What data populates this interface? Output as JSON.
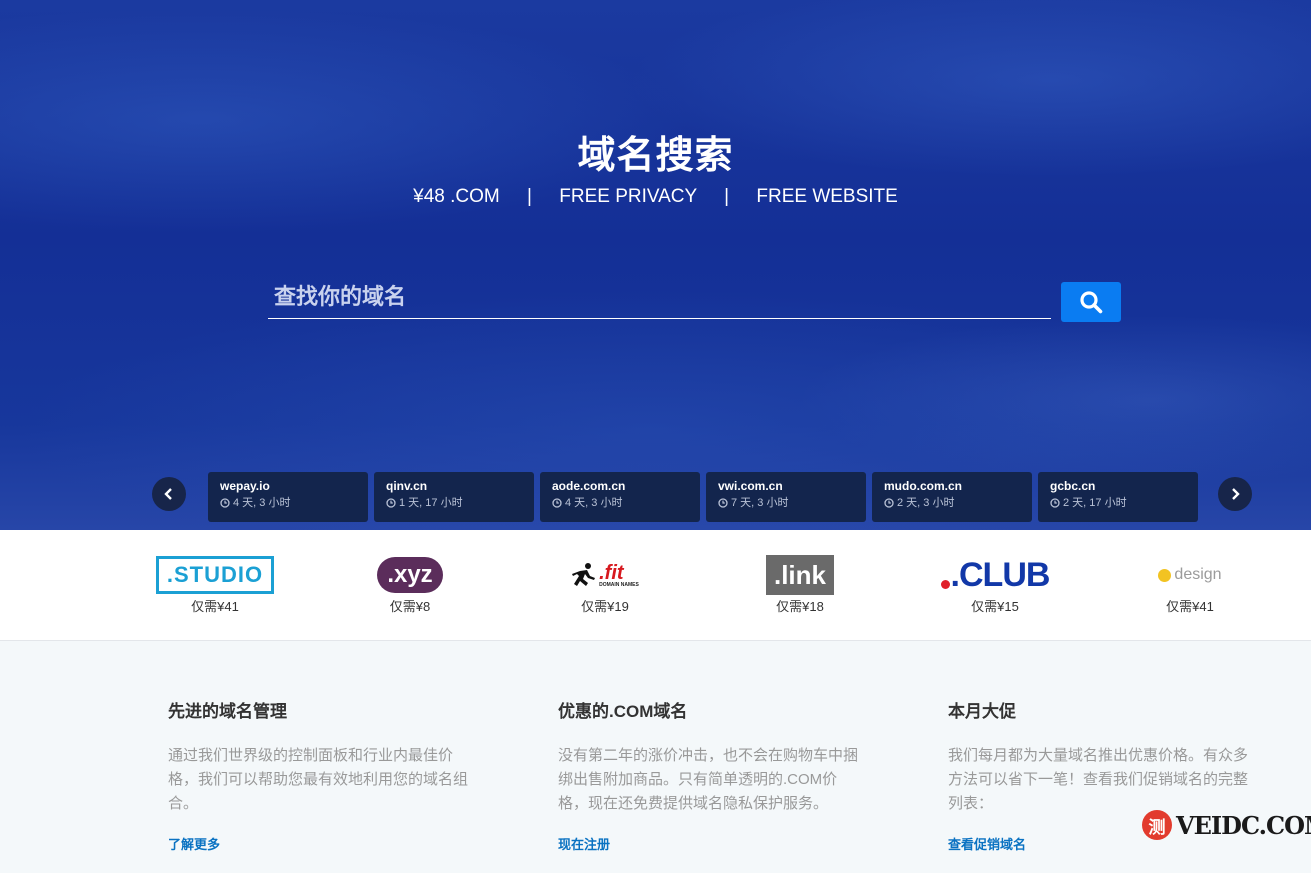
{
  "hero": {
    "title": "域名搜索",
    "tagline_1": "¥48 .COM",
    "tagline_sep": "|",
    "tagline_2": "FREE PRIVACY",
    "tagline_3": "FREE WEBSITE",
    "search_placeholder": "查找你的域名",
    "search_value": ""
  },
  "ticker": [
    {
      "domain": "wepay.io",
      "time": "4 天, 3 小时"
    },
    {
      "domain": "qinv.cn",
      "time": "1 天, 17 小时"
    },
    {
      "domain": "aode.com.cn",
      "time": "4 天, 3 小时"
    },
    {
      "domain": "vwi.com.cn",
      "time": "7 天, 3 小时"
    },
    {
      "domain": "mudo.com.cn",
      "time": "2 天, 3 小时"
    },
    {
      "domain": "gcbc.cn",
      "time": "2 天, 17 小时"
    }
  ],
  "tlds": [
    {
      "logo": ".STUDIO",
      "price": "仅需¥41"
    },
    {
      "logo": ".xyz",
      "price": "仅需¥8"
    },
    {
      "logo": ".fit",
      "logo_small": "DOMAIN NAMES",
      "price": "仅需¥19"
    },
    {
      "logo": ".link",
      "price": "仅需¥18"
    },
    {
      "logo": ".CLUB",
      "price": "仅需¥15"
    },
    {
      "logo": "design",
      "price": "仅需¥41"
    }
  ],
  "features": [
    {
      "title": "先进的域名管理",
      "body": "通过我们世界级的控制面板和行业内最佳价格，我们可以帮助您最有效地利用您的域名组合。",
      "link": "了解更多"
    },
    {
      "title": "优惠的.COM域名",
      "body": "没有第二年的涨价冲击，也不会在购物车中捆绑出售附加商品。只有简单透明的.COM价格，现在还免费提供域名隐私保护服务。",
      "link": "现在注册"
    },
    {
      "title": "本月大促",
      "body": "我们每月都为大量域名推出优惠价格。有众多方法可以省下一笔！查看我们促销域名的完整列表：",
      "link": "查看促销域名"
    }
  ],
  "watermark": {
    "badge": "测",
    "text": "VEIDC.COM"
  },
  "colors": {
    "hero_blue": "#17379c",
    "search_button": "#0a7cf2",
    "ticker_card": "#13254d",
    "link_blue": "#0a72c2",
    "features_bg": "#f4f8fa"
  }
}
